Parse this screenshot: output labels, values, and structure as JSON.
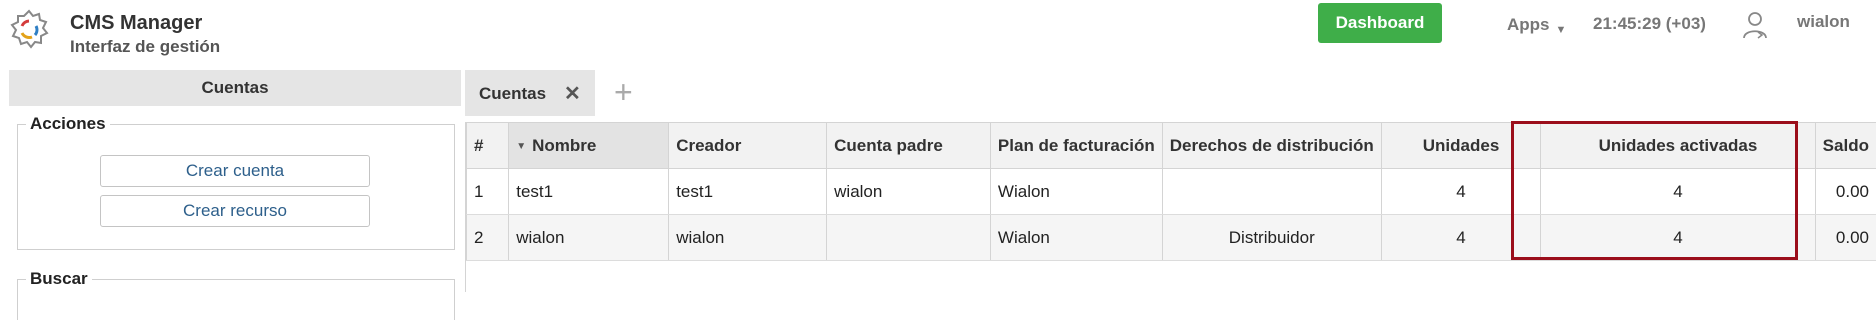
{
  "header": {
    "title": "CMS Manager",
    "subtitle": "Interfaz de gestión",
    "dashboard_label": "Dashboard",
    "apps_label": "Apps",
    "clock": "21:45:29 (+03)",
    "username": "wialon",
    "dashboard_color": "#3fae49"
  },
  "left_panel": {
    "title": "Cuentas",
    "actions": {
      "legend": "Acciones",
      "create_account": "Crear cuenta",
      "create_resource": "Crear recurso"
    },
    "search": {
      "legend": "Buscar"
    }
  },
  "tabs": [
    {
      "label": "Cuentas",
      "active": true
    }
  ],
  "grid": {
    "columns": [
      "#",
      "Nombre",
      "Creador",
      "Cuenta padre",
      "Plan de facturación",
      "Derechos de distribución",
      "Unidades",
      "Unidades activadas",
      "Saldo"
    ],
    "rows": [
      [
        "1",
        "test1",
        "test1",
        "wialon",
        "Wialon",
        "",
        "4",
        "4",
        "0.00"
      ],
      [
        "2",
        "wialon",
        "wialon",
        "",
        "Wialon",
        "Distribuidor",
        "4",
        "4",
        "0.00"
      ]
    ],
    "highlight_color": "#9b0e1b"
  },
  "icons": {
    "logo": "gear-logo-icon",
    "apps_caret": "caret-down-icon",
    "user": "user-icon",
    "tab_close": "close-icon",
    "tab_add": "plus-icon",
    "sort": "sort-desc-icon"
  }
}
